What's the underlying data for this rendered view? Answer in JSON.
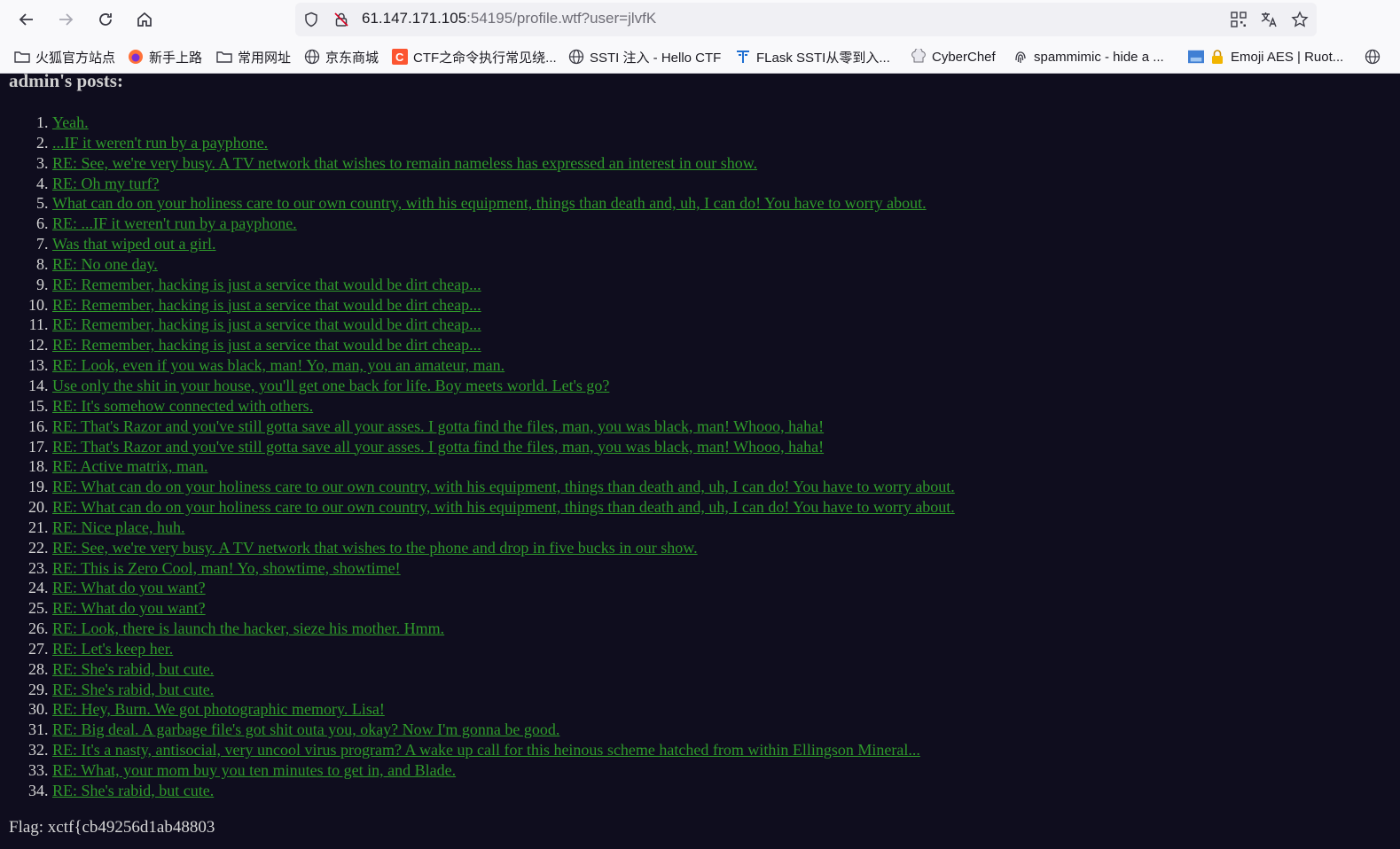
{
  "browser": {
    "url_host": "61.147.171.105",
    "url_rest": ":54195/profile.wtf?user=jlvfK",
    "bookmarks": [
      {
        "label": "火狐官方站点",
        "icon": "folder-icon"
      },
      {
        "label": "新手上路",
        "icon": "firefox-icon"
      },
      {
        "label": "常用网址",
        "icon": "folder-icon"
      },
      {
        "label": "京东商城",
        "icon": "globe-icon"
      },
      {
        "label": "CTF之命令执行常见绕...",
        "icon": "csdn-icon"
      },
      {
        "label": "SSTI 注入 - Hello CTF",
        "icon": "globe-icon"
      },
      {
        "label": "FLask SSTI从零到入...",
        "icon": "site-icon"
      },
      {
        "label": "CyberChef",
        "icon": "chef-hat-icon"
      },
      {
        "label": "spammimic - hide a ...",
        "icon": "fingerprint-icon"
      },
      {
        "label": "Emoji AES | Ruot...",
        "icon": "lock-icon"
      },
      {
        "label": "",
        "icon": "globe-icon"
      }
    ]
  },
  "page": {
    "heading": "admin's posts:",
    "posts": [
      "Yeah.",
      "...IF it weren't run by a payphone.",
      "RE: See, we're very busy. A TV network that wishes to remain nameless has expressed an interest in our show.",
      "RE: Oh my turf?",
      "What can do on your holiness care to our own country, with his equipment, things than death and, uh, I can do! You have to worry about.",
      "RE: ...IF it weren't run by a payphone.",
      "Was that wiped out a girl.",
      "RE: No one day.",
      "RE: Remember, hacking is just a service that would be dirt cheap...",
      "RE: Remember, hacking is just a service that would be dirt cheap...",
      "RE: Remember, hacking is just a service that would be dirt cheap...",
      "RE: Remember, hacking is just a service that would be dirt cheap...",
      "RE: Look, even if you was black, man! Yo, man, you an amateur, man.",
      "Use only the shit in your house, you'll get one back for life. Boy meets world. Let's go?",
      "RE: It's somehow connected with others.",
      "RE: That's Razor and you've still gotta save all your asses. I gotta find the files, man, you was black, man! Whooo, haha!",
      "RE: That's Razor and you've still gotta save all your asses. I gotta find the files, man, you was black, man! Whooo, haha!",
      "RE: Active matrix, man.",
      "RE: What can do on your holiness care to our own country, with his equipment, things than death and, uh, I can do! You have to worry about.",
      "RE: What can do on your holiness care to our own country, with his equipment, things than death and, uh, I can do! You have to worry about.",
      "RE: Nice place, huh.",
      "RE: See, we're very busy. A TV network that wishes to the phone and drop in five bucks in our show.",
      "RE: This is Zero Cool, man! Yo, showtime, showtime!",
      "RE: What do you want?",
      "RE: What do you want?",
      "RE: Look, there is launch the hacker, sieze his mother. Hmm.",
      "RE: Let's keep her.",
      "RE: She's rabid, but cute.",
      "RE: She's rabid, but cute.",
      "RE: Hey, Burn. We got photographic memory. Lisa!",
      "RE: Big deal. A garbage file's got shit outa you, okay? Now I'm gonna be good.",
      "RE: It's a nasty, antisocial, very uncool virus program? A wake up call for this heinous scheme hatched from within Ellingson Mineral...",
      "RE: What, your mom buy you ten minutes to get in, and Blade.",
      "RE: She's rabid, but cute."
    ],
    "flag": "Flag: xctf{cb49256d1ab48803"
  },
  "colors": {
    "page_bg": "#0f0d1e",
    "link": "#2f9a2b",
    "text": "#d6d6d6"
  }
}
